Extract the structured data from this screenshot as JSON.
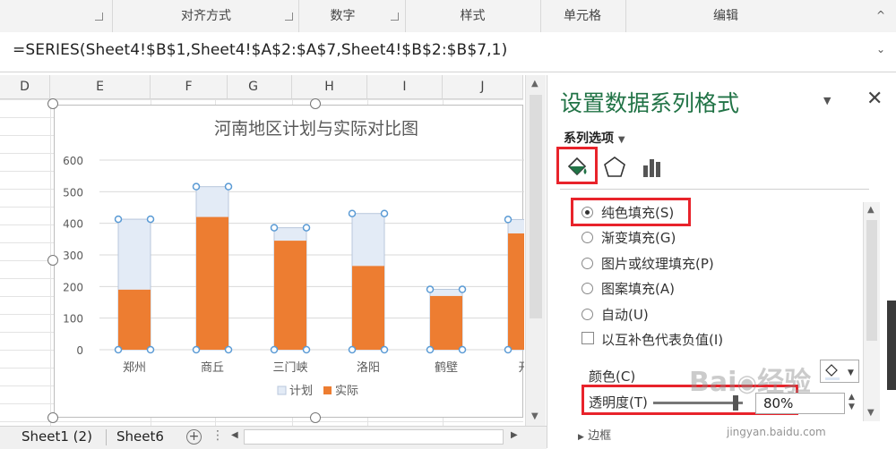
{
  "ribbon": {
    "groups": [
      "对齐方式",
      "数字",
      "样式",
      "单元格",
      "编辑"
    ]
  },
  "formula_bar": {
    "formula": "=SERIES(Sheet4!$B$1,Sheet4!$A$2:$A$7,Sheet4!$B$2:$B$7,1)"
  },
  "columns": [
    "D",
    "E",
    "F",
    "G",
    "H",
    "I",
    "J"
  ],
  "chart_data": {
    "type": "bar",
    "title": "河南地区计划与实际对比图",
    "categories": [
      "郑州",
      "商丘",
      "三门峡",
      "洛阳",
      "鹤壁",
      "开"
    ],
    "series": [
      {
        "name": "计划",
        "values": [
          413,
          516,
          386,
          431,
          191,
          412
        ],
        "color": "#e3ebf6"
      },
      {
        "name": "实际",
        "values": [
          190,
          420,
          345,
          265,
          170,
          368
        ],
        "color": "#ed7d31"
      }
    ],
    "ylim": [
      0,
      600
    ],
    "yticks": [
      "600",
      "500",
      "400",
      "300",
      "200",
      "100",
      "0"
    ],
    "grid": true,
    "legend": "bottom",
    "overlap": true
  },
  "sheet_tabs": [
    "Sheet1 (2)",
    "Sheet6"
  ],
  "pane": {
    "title": "设置数据系列格式",
    "section": "系列选项",
    "fill_options": [
      {
        "label": "纯色填充(S)",
        "selected": true
      },
      {
        "label": "渐变填充(G)",
        "selected": false
      },
      {
        "label": "图片或纹理填充(P)",
        "selected": false
      },
      {
        "label": "图案填充(A)",
        "selected": false
      },
      {
        "label": "自动(U)",
        "selected": false
      }
    ],
    "invert_label": "以互补色代表负值(I)",
    "color_label": "颜色(C)",
    "transparency_label": "透明度(T)",
    "transparency_value": "80%",
    "transparency_fraction": 0.8,
    "next_section": "边框"
  },
  "watermark": {
    "brand": "Baidu 经验",
    "url": "jingyan.baidu.com"
  },
  "colors": {
    "accent_green": "#217346",
    "highlight_red": "#e8232b",
    "orange": "#ed7d31"
  }
}
